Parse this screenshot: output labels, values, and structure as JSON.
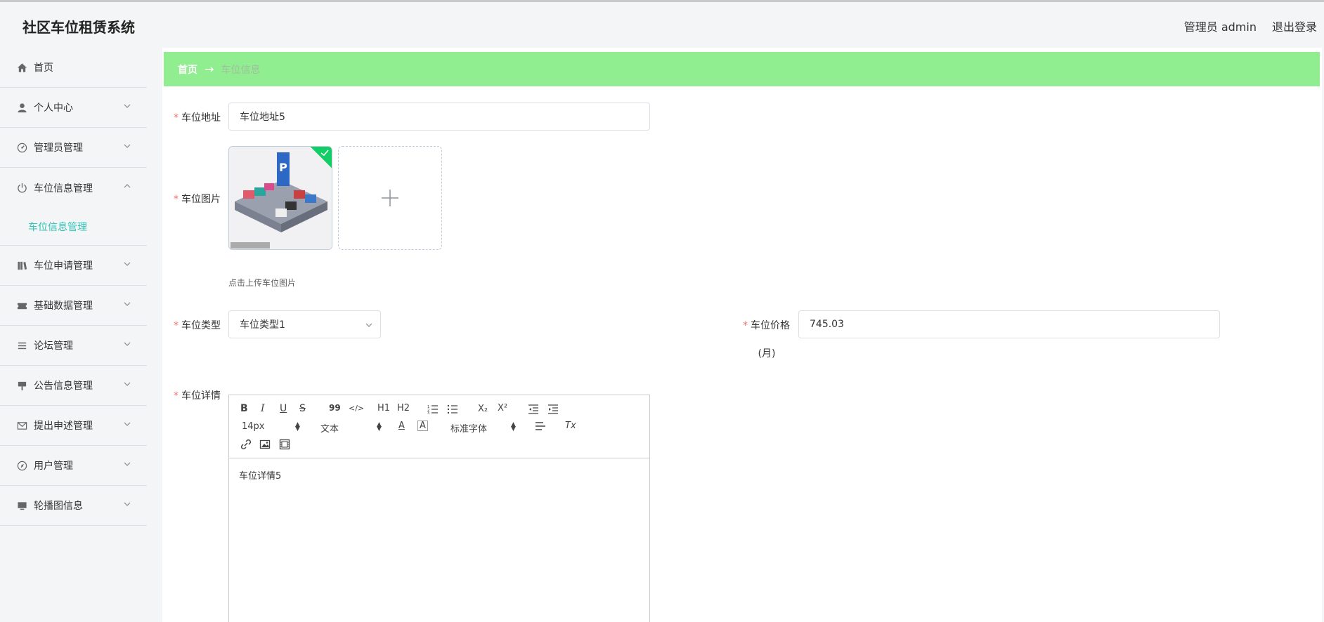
{
  "header": {
    "app_title": "社区车位租赁系统",
    "user_label": "管理员 admin",
    "logout_label": "退出登录"
  },
  "sidebar": {
    "items": [
      {
        "label": "首页",
        "icon": "home-icon"
      },
      {
        "label": "个人中心",
        "icon": "user-icon"
      },
      {
        "label": "管理员管理",
        "icon": "gauge-icon"
      },
      {
        "label": "车位信息管理",
        "icon": "power-icon",
        "open": true
      },
      {
        "label": "车位申请管理",
        "icon": "books-icon"
      },
      {
        "label": "基础数据管理",
        "icon": "ticket-icon"
      },
      {
        "label": "论坛管理",
        "icon": "list-icon"
      },
      {
        "label": "公告信息管理",
        "icon": "sign-icon"
      },
      {
        "label": "提出申述管理",
        "icon": "mail-icon"
      },
      {
        "label": "用户管理",
        "icon": "compass-icon"
      },
      {
        "label": "轮播图信息",
        "icon": "monitor-icon"
      }
    ],
    "sub_item": "车位信息管理",
    "active_color": "#2ec4b6"
  },
  "breadcrumb": {
    "home": "首页",
    "arrow": "→",
    "current": "车位信息"
  },
  "form": {
    "address_label": "车位地址",
    "address_value": "车位地址5",
    "image_label": "车位图片",
    "image_tip": "点击上传车位图片",
    "type_label": "车位类型",
    "type_value": "车位类型1",
    "price_label": "车位价格",
    "price_unit": "(月)",
    "price_value": "745.03",
    "detail_label": "车位详情",
    "required_mark": "*"
  },
  "editor": {
    "font_size": "14px",
    "header_select": "文本",
    "font_family": "标准字体",
    "content": "车位详情5",
    "tools": {
      "bold": "B",
      "italic": "I",
      "underline": "U",
      "strike": "S",
      "quote": "99",
      "code": "</>",
      "h1": "H1",
      "h2": "H2",
      "sub": "X₂",
      "sup": "X²",
      "font_color": "A",
      "bg_color": "A",
      "clean": "Tx"
    }
  },
  "colors": {
    "breadcrumb_bg": "#90ee90",
    "required": "#f56c6c",
    "upload_success": "#13ce66"
  }
}
